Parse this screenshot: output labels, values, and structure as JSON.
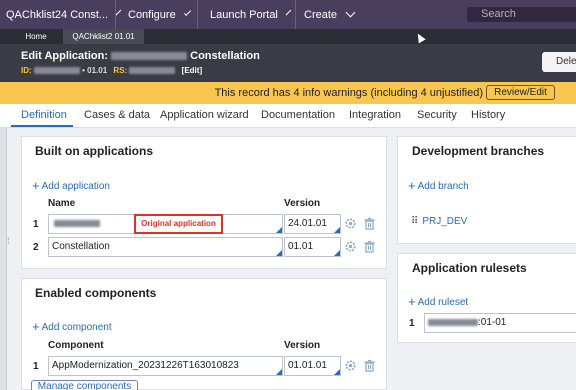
{
  "topbar": {
    "app_menu": "QAChklist24 Const...",
    "configure": "Configure",
    "launch_portal": "Launch Portal",
    "create": "Create",
    "search_placeholder": "Search"
  },
  "tabs": {
    "home": "Home",
    "app": "QAChklist2 01.01"
  },
  "header": {
    "edit_prefix": "Edit",
    "title_label": "Application:",
    "title_name": "Constellation",
    "id_label": "ID:",
    "id_version": "• 01.01",
    "rs_label": "RS:",
    "edit_link": "[Edit]",
    "delete_label": "Dele"
  },
  "warning": {
    "text": "This record has 4 info warnings (including 4 unjustified)",
    "review_label": "Review/Edit"
  },
  "nav_tabs": [
    "Definition",
    "Cases & data",
    "Application wizard",
    "Documentation",
    "Integration",
    "Security",
    "History"
  ],
  "built_on": {
    "title": "Built on applications",
    "add_label": "Add application",
    "col_name": "Name",
    "col_version": "Version",
    "rows": [
      {
        "num": "1",
        "name": "",
        "version": "24.01.01"
      },
      {
        "num": "2",
        "name": "Constellation",
        "version": "01.01"
      }
    ],
    "annotation": "Original application"
  },
  "enabled": {
    "title": "Enabled components",
    "add_label": "Add component",
    "col_name": "Component",
    "col_version": "Version",
    "rows": [
      {
        "num": "1",
        "name": "AppModernization_20231226T163010823",
        "version": "01.01.01"
      }
    ],
    "manage_label": "Manage components"
  },
  "dev_branches": {
    "title": "Development branches",
    "add_label": "Add branch",
    "branch": "PRJ_DEV"
  },
  "rulesets": {
    "title": "Application rulesets",
    "add_label": "Add ruleset",
    "rows": [
      {
        "num": "1",
        "version_suffix": ":01-01"
      }
    ]
  },
  "colors": {
    "topbar": "#4a3e5e",
    "header": "#3b3b46",
    "warning": "#f9c74f",
    "link": "#2a6bb5",
    "annotation": "#d32f2f"
  }
}
